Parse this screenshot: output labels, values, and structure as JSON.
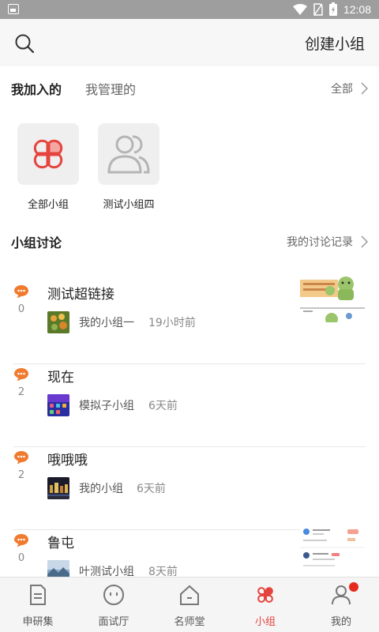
{
  "status_bar": {
    "time": "12:08",
    "icons": [
      "gallery-icon",
      "wifi-icon",
      "no-sim-icon",
      "battery-charging-icon"
    ]
  },
  "header": {
    "create_group_label": "创建小组",
    "search_icon": "search-icon"
  },
  "tabs": {
    "joined": "我加入的",
    "managed": "我管理的",
    "all": "全部"
  },
  "groups": [
    {
      "label": "全部小组",
      "icon": "group-logo-icon",
      "accent": "#e5443e"
    },
    {
      "label": "测试小组四",
      "icon": "people-icon"
    }
  ],
  "discussions_section": {
    "title": "小组讨论",
    "history_label": "我的讨论记录"
  },
  "discussions": [
    {
      "title": "测试超链接",
      "count": "0",
      "group": "我的小组一",
      "time": "19小时前"
    },
    {
      "title": "现在",
      "count": "2",
      "group": "模拟子小组",
      "time": "6天前"
    },
    {
      "title": "哦哦哦",
      "count": "2",
      "group": "我的小组",
      "time": "6天前"
    },
    {
      "title": "鲁屯",
      "count": "0",
      "group": "叶测试小组",
      "time": "8天前"
    }
  ],
  "bottom_nav": [
    {
      "label": "申研集",
      "icon": "document-icon",
      "active": false
    },
    {
      "label": "面试厅",
      "icon": "face-icon",
      "active": false
    },
    {
      "label": "名师堂",
      "icon": "home-icon",
      "active": false
    },
    {
      "label": "小组",
      "icon": "group-logo-icon",
      "active": true
    },
    {
      "label": "我的",
      "icon": "user-icon",
      "active": false
    }
  ],
  "colors": {
    "accent": "#e5443e",
    "bubble": "#f07a2e",
    "header_bg": "#f7f7f7",
    "status_bar": "#9e9e9e"
  }
}
